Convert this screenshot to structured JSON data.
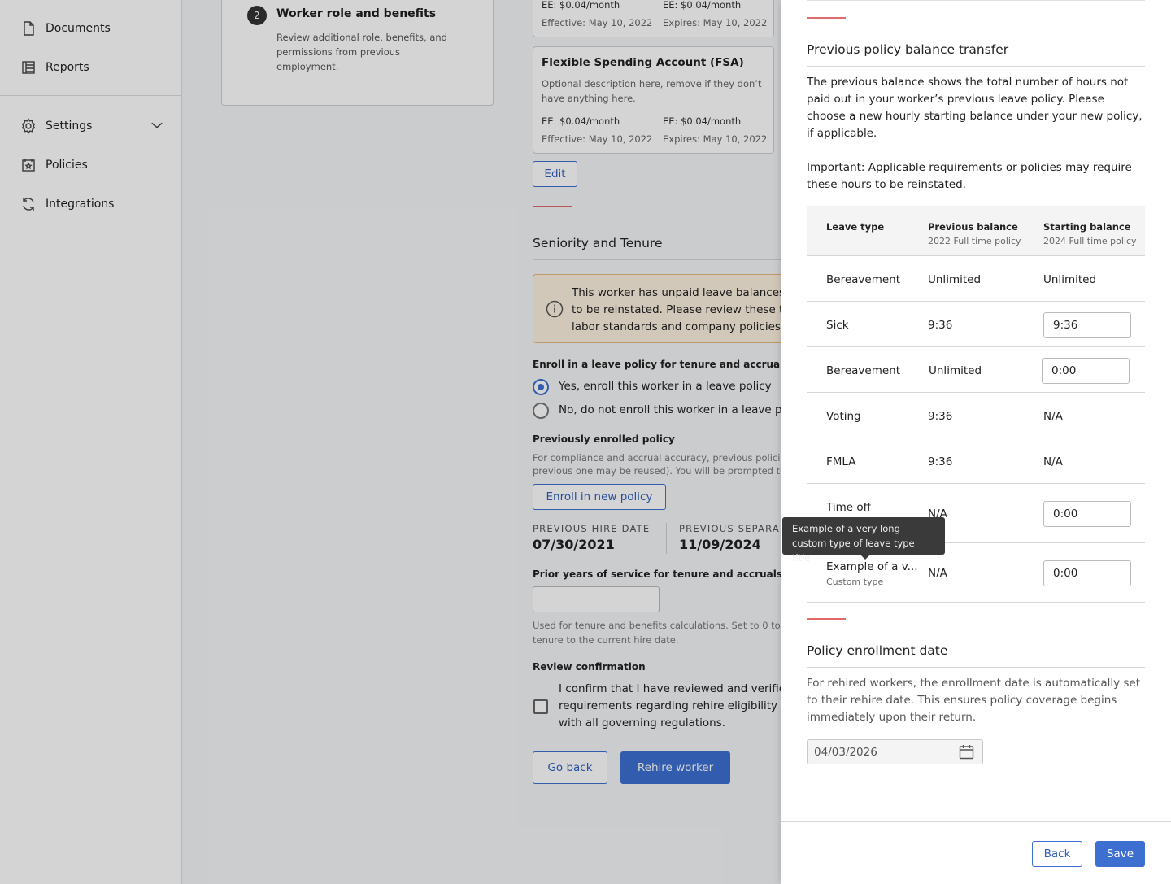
{
  "sidebar": {
    "items": [
      {
        "label": "Documents",
        "icon": "document-icon"
      },
      {
        "label": "Reports",
        "icon": "table-icon"
      },
      {
        "label": "Settings",
        "icon": "gear-icon"
      },
      {
        "label": "Policies",
        "icon": "calendar-star-icon"
      },
      {
        "label": "Integrations",
        "icon": "sync-icon"
      }
    ]
  },
  "step": {
    "number": "2",
    "title": "Worker role and benefits",
    "description": "Review additional role, benefits, and permissions from previous employment."
  },
  "benefit_top": {
    "ee_left": "EE: $0.04/month",
    "ee_right": "EE: $0.04/month",
    "effective": "Effective: May 10, 2022",
    "expires": "Expires: May 10, 2022"
  },
  "fsa_card": {
    "title": "Flexible Spending Account (FSA)",
    "description": "Optional description here, remove if they don’t have anything here.",
    "ee_left": "EE: $0.04/month",
    "ee_right": "EE: $0.04/month",
    "effective": "Effective: May 10, 2022",
    "expires": "Expires: May 10, 2022"
  },
  "edit_button": "Edit",
  "seniority": {
    "title": "Seniority and Tenure",
    "warning_lines": [
      "This worker has unpaid leave balances",
      "to be reinstated. Please review these t",
      "labor standards and company policies"
    ],
    "enroll_label": "Enroll in a leave policy for tenure and accruals",
    "radio_yes": "Yes, enroll this worker in a leave policy",
    "radio_no": "No, do not enroll this worker in a leave p",
    "prev_policy_label": "Previously enrolled policy",
    "prev_policy_desc_1": "For compliance and accrual accuracy, previous policies",
    "prev_policy_desc_2": "previous one may be reused). You will be prompted to",
    "enroll_button": "Enroll in new policy",
    "prev_hire_caption": "PREVIOUS HIRE DATE",
    "prev_hire_date": "07/30/2021",
    "prev_sep_caption": "PREVIOUS SEPARA",
    "prev_sep_date": "11/09/2024",
    "prior_years_label": "Prior years of service for tenure and accruals",
    "prior_years_value": "",
    "prior_years_help_1": "Used for tenure and benefits calculations. Set to 0 to",
    "prior_years_help_2": "tenure to the current hire date.",
    "review_label": "Review confirmation",
    "confirm_lines": [
      "I confirm that I have reviewed and verifie",
      "requirements regarding rehire eligibility",
      "with all governing regulations."
    ],
    "go_back": "Go back",
    "rehire": "Rehire worker"
  },
  "panel": {
    "transfer_title": "Previous policy balance transfer",
    "transfer_desc": "The previous balance shows the total number of hours not paid out in your worker’s previous leave policy. Please choose a new hourly starting balance under your new policy, if applicable.",
    "important": "Important: Applicable requirements or policies may require these hours to be reinstated.",
    "table": {
      "col_leave": "Leave type",
      "col_prev": "Previous balance",
      "col_prev_sub": "2022 Full time policy",
      "col_start": "Starting balance",
      "col_start_sub": "2024 Full time policy",
      "rows": [
        {
          "type": "Bereavement",
          "sub": "",
          "prev": "Unlimited",
          "start": "Unlimited"
        },
        {
          "type": "Sick",
          "sub": "",
          "prev": "9:36",
          "start": "9:36"
        },
        {
          "type": "Bereavement",
          "sub": "",
          "prev": "Unlimited",
          "start": "0:00"
        },
        {
          "type": "Voting",
          "sub": "",
          "prev": "9:36",
          "start": "N/A"
        },
        {
          "type": "FMLA",
          "sub": "",
          "prev": "9:36",
          "start": "N/A"
        },
        {
          "type": "Time off",
          "sub": "",
          "prev": "N/A",
          "start": "0:00"
        },
        {
          "type": "Example of a v...",
          "sub": "Custom type",
          "prev": "N/A",
          "start": "0:00"
        }
      ]
    },
    "tooltip": "Example of a very long custom type of leave type title",
    "enroll_title": "Policy enrollment date",
    "enroll_desc": "For rehired workers, the enrollment date is automatically set to their rehire date. This ensures policy coverage begins immediately upon their return.",
    "enroll_date": "04/03/2026",
    "back": "Back",
    "save": "Save"
  },
  "colors": {
    "primary": "#3d6fd1",
    "accent_line": "#e06a6a",
    "warning_bg": "#fdf1e0",
    "tooltip_bg": "#3a3a3a"
  }
}
